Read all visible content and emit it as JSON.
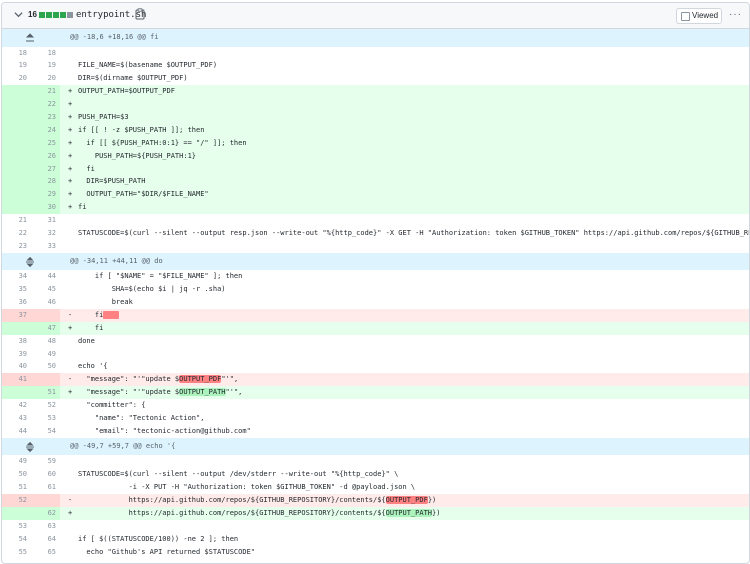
{
  "file_header": {
    "change_count": "16",
    "filename": "entrypoint.sh",
    "viewed_label": "Viewed",
    "more_label": "···",
    "diffstat_colors": [
      "#2da44e",
      "#2da44e",
      "#2da44e",
      "#2da44e",
      "#8c959f"
    ]
  },
  "colors": {
    "add_bg": "#e6ffec",
    "add_num_bg": "#ccffd8",
    "del_bg": "#ffebe9",
    "del_num_bg": "#ffd7d5",
    "hunk_bg": "#ddf4ff"
  },
  "lines": [
    {
      "type": "hunk",
      "icon": "expand-up",
      "text": "@@ -18,6 +18,16 @@ fi"
    },
    {
      "type": "ctx",
      "old": "18",
      "new": "18",
      "sign": "",
      "text": ""
    },
    {
      "type": "ctx",
      "old": "19",
      "new": "19",
      "sign": "",
      "text": "FILE_NAME=$(basename $OUTPUT_PDF)"
    },
    {
      "type": "ctx",
      "old": "20",
      "new": "20",
      "sign": "",
      "text": "DIR=$(dirname $OUTPUT_PDF)"
    },
    {
      "type": "add",
      "old": "",
      "new": "21",
      "sign": "+",
      "text": "OUTPUT_PATH=$OUTPUT_PDF"
    },
    {
      "type": "add",
      "old": "",
      "new": "22",
      "sign": "+",
      "text": ""
    },
    {
      "type": "add",
      "old": "",
      "new": "23",
      "sign": "+",
      "text": "PUSH_PATH=$3"
    },
    {
      "type": "add",
      "old": "",
      "new": "24",
      "sign": "+",
      "text": "if [[ ! -z $PUSH_PATH ]]; then"
    },
    {
      "type": "add",
      "old": "",
      "new": "25",
      "sign": "+",
      "text": "  if [[ ${PUSH_PATH:0:1} == \"/\" ]]; then"
    },
    {
      "type": "add",
      "old": "",
      "new": "26",
      "sign": "+",
      "text": "    PUSH_PATH=${PUSH_PATH:1}"
    },
    {
      "type": "add",
      "old": "",
      "new": "27",
      "sign": "+",
      "text": "  fi"
    },
    {
      "type": "add",
      "old": "",
      "new": "28",
      "sign": "+",
      "text": "  DIR=$PUSH_PATH"
    },
    {
      "type": "add",
      "old": "",
      "new": "29",
      "sign": "+",
      "text": "  OUTPUT_PATH=\"$DIR/$FILE_NAME\""
    },
    {
      "type": "add",
      "old": "",
      "new": "30",
      "sign": "+",
      "text": "fi"
    },
    {
      "type": "ctx",
      "old": "21",
      "new": "31",
      "sign": "",
      "text": ""
    },
    {
      "type": "ctx",
      "old": "22",
      "new": "32",
      "sign": "",
      "text": "STATUSCODE=$(curl --silent --output resp.json --write-out \"%{http_code}\" -X GET -H \"Authorization: token $GITHUB_TOKEN\" https://api.github.com/repos/${GITHUB_REPOSITO"
    },
    {
      "type": "ctx",
      "old": "23",
      "new": "33",
      "sign": "",
      "text": ""
    },
    {
      "type": "hunk",
      "icon": "expand-both",
      "text": "@@ -34,11 +44,11 @@ do"
    },
    {
      "type": "ctx",
      "old": "34",
      "new": "44",
      "sign": "",
      "text": "    if [ \"$NAME\" = \"$FILE_NAME\" ]; then"
    },
    {
      "type": "ctx",
      "old": "35",
      "new": "45",
      "sign": "",
      "text": "        SHA=$(echo $i | jq -r .sha)"
    },
    {
      "type": "ctx",
      "old": "36",
      "new": "46",
      "sign": "",
      "text": "        break"
    },
    {
      "type": "del",
      "old": "37",
      "new": "",
      "sign": "-",
      "text": "    fi",
      "trail": true
    },
    {
      "type": "add",
      "old": "",
      "new": "47",
      "sign": "+",
      "text": "    fi"
    },
    {
      "type": "ctx",
      "old": "38",
      "new": "48",
      "sign": "",
      "text": "done"
    },
    {
      "type": "ctx",
      "old": "39",
      "new": "49",
      "sign": "",
      "text": ""
    },
    {
      "type": "ctx",
      "old": "40",
      "new": "50",
      "sign": "",
      "text": "echo '{"
    },
    {
      "type": "del",
      "old": "41",
      "new": "",
      "sign": "-",
      "text": "  \"message\": \"'\"update $",
      "hl": "OUTPUT_PDF",
      "post": "\"'\","
    },
    {
      "type": "add",
      "old": "",
      "new": "51",
      "sign": "+",
      "text": "  \"message\": \"'\"update $",
      "hl": "OUTPUT_PATH",
      "post": "\"'\","
    },
    {
      "type": "ctx",
      "old": "42",
      "new": "52",
      "sign": "",
      "text": "  \"committer\": {"
    },
    {
      "type": "ctx",
      "old": "43",
      "new": "53",
      "sign": "",
      "text": "    \"name\": \"Tectonic Action\","
    },
    {
      "type": "ctx",
      "old": "44",
      "new": "54",
      "sign": "",
      "text": "    \"email\": \"tectonic-action@github.com\""
    },
    {
      "type": "hunk",
      "icon": "expand-both",
      "text": "@@ -49,7 +59,7 @@ echo '{"
    },
    {
      "type": "ctx",
      "old": "49",
      "new": "59",
      "sign": "",
      "text": ""
    },
    {
      "type": "ctx",
      "old": "50",
      "new": "60",
      "sign": "",
      "text": "STATUSCODE=$(curl --silent --output /dev/stderr --write-out \"%{http_code}\" \\"
    },
    {
      "type": "ctx",
      "old": "51",
      "new": "61",
      "sign": "",
      "text": "            -i -X PUT -H \"Authorization: token $GITHUB_TOKEN\" -d @payload.json \\"
    },
    {
      "type": "del",
      "old": "52",
      "new": "",
      "sign": "-",
      "text": "            https://api.github.com/repos/${GITHUB_REPOSITORY}/contents/${",
      "hl": "OUTPUT_PDF",
      "post": "})"
    },
    {
      "type": "add",
      "old": "",
      "new": "62",
      "sign": "+",
      "text": "            https://api.github.com/repos/${GITHUB_REPOSITORY}/contents/${",
      "hl": "OUTPUT_PATH",
      "post": "})"
    },
    {
      "type": "ctx",
      "old": "53",
      "new": "63",
      "sign": "",
      "text": ""
    },
    {
      "type": "ctx",
      "old": "54",
      "new": "64",
      "sign": "",
      "text": "if [ $((STATUSCODE/100)) -ne 2 ]; then"
    },
    {
      "type": "ctx",
      "old": "55",
      "new": "65",
      "sign": "",
      "text": "  echo \"Github's API returned $STATUSCODE\""
    }
  ]
}
